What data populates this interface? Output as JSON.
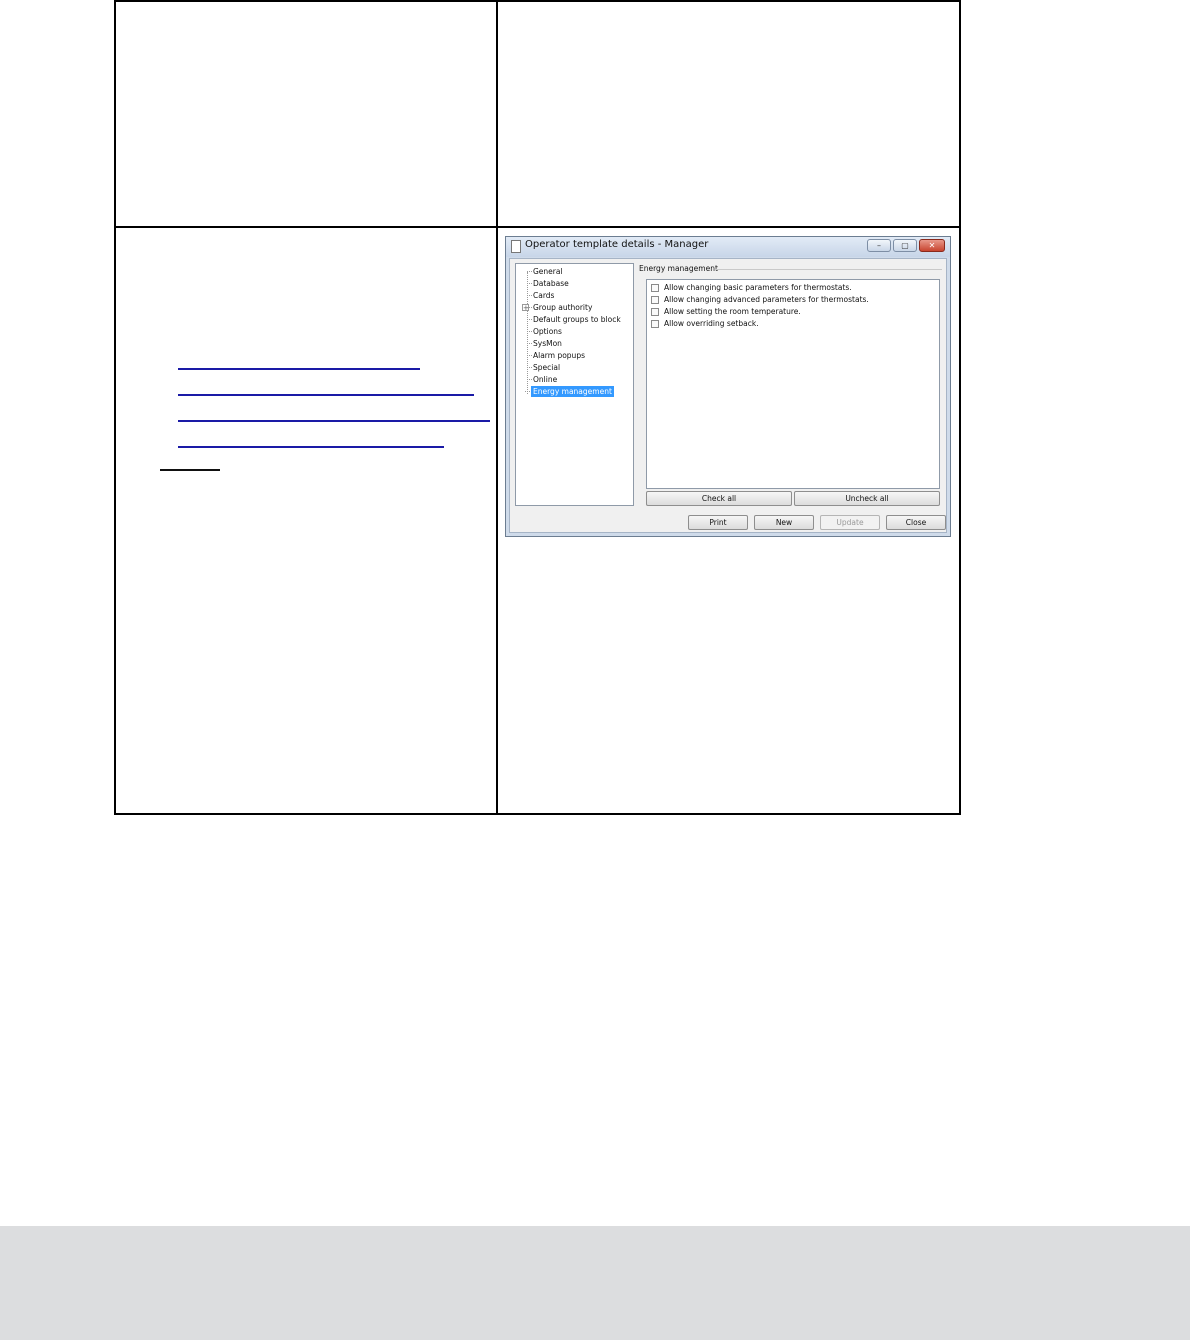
{
  "window": {
    "title": "Operator template details - Manager",
    "controls": {
      "minimize": "–",
      "maximize": "▢",
      "close": "✕"
    }
  },
  "tree": {
    "items": [
      {
        "label": "General"
      },
      {
        "label": "Database"
      },
      {
        "label": "Cards"
      },
      {
        "label": "Group authority",
        "expander": "+"
      },
      {
        "label": "Default groups to block"
      },
      {
        "label": "Options"
      },
      {
        "label": "SysMon"
      },
      {
        "label": "Alarm popups"
      },
      {
        "label": "Special"
      },
      {
        "label": "Online"
      },
      {
        "label": "Energy management",
        "selected": true
      }
    ]
  },
  "group": {
    "label": "Energy management",
    "options": [
      "Allow changing basic parameters for thermostats.",
      "Allow changing advanced parameters for thermostats.",
      "Allow setting the room temperature.",
      "Allow overriding setback."
    ]
  },
  "buttons": {
    "check_all": "Check all",
    "uncheck_all": "Uncheck all",
    "print": "Print",
    "new": "New",
    "update": "Update",
    "close": "Close"
  }
}
